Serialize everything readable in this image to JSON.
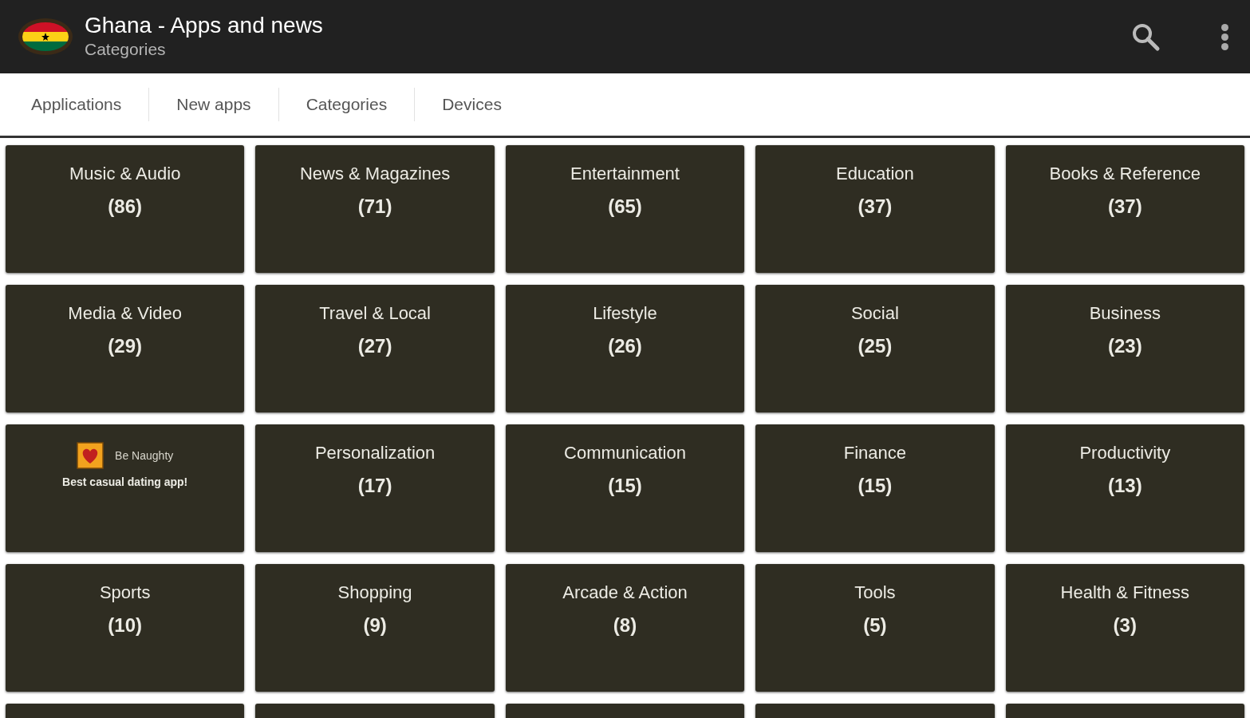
{
  "app_bar": {
    "title": "Ghana - Apps and news",
    "subtitle": "Categories"
  },
  "tabs": [
    {
      "label": "Applications"
    },
    {
      "label": "New apps"
    },
    {
      "label": "Categories"
    },
    {
      "label": "Devices"
    }
  ],
  "tiles": [
    {
      "kind": "category",
      "name": "Music & Audio",
      "count": "(86)"
    },
    {
      "kind": "category",
      "name": "News & Magazines",
      "count": "(71)"
    },
    {
      "kind": "category",
      "name": "Entertainment",
      "count": "(65)"
    },
    {
      "kind": "category",
      "name": "Education",
      "count": "(37)"
    },
    {
      "kind": "category",
      "name": "Books & Reference",
      "count": "(37)"
    },
    {
      "kind": "category",
      "name": "Media & Video",
      "count": "(29)"
    },
    {
      "kind": "category",
      "name": "Travel & Local",
      "count": "(27)"
    },
    {
      "kind": "category",
      "name": "Lifestyle",
      "count": "(26)"
    },
    {
      "kind": "category",
      "name": "Social",
      "count": "(25)"
    },
    {
      "kind": "category",
      "name": "Business",
      "count": "(23)"
    },
    {
      "kind": "ad",
      "name": "Be Naughty",
      "tagline": "Best casual dating app!"
    },
    {
      "kind": "category",
      "name": "Personalization",
      "count": "(17)"
    },
    {
      "kind": "category",
      "name": "Communication",
      "count": "(15)"
    },
    {
      "kind": "category",
      "name": "Finance",
      "count": "(15)"
    },
    {
      "kind": "category",
      "name": "Productivity",
      "count": "(13)"
    },
    {
      "kind": "category",
      "name": "Sports",
      "count": "(10)"
    },
    {
      "kind": "category",
      "name": "Shopping",
      "count": "(9)"
    },
    {
      "kind": "category",
      "name": "Arcade & Action",
      "count": "(8)"
    },
    {
      "kind": "category",
      "name": "Tools",
      "count": "(5)"
    },
    {
      "kind": "category",
      "name": "Health & Fitness",
      "count": "(3)"
    },
    {
      "kind": "partial"
    },
    {
      "kind": "partial"
    },
    {
      "kind": "partial"
    },
    {
      "kind": "partial"
    },
    {
      "kind": "partial"
    }
  ]
}
